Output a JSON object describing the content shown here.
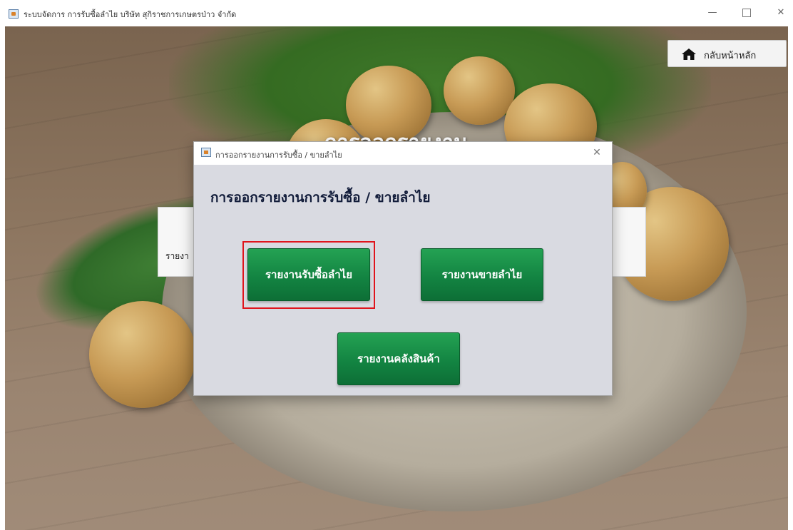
{
  "window": {
    "title": "ระบบจัดการ การรับซื้อลำไย บริษัท สุกิราชการเกษตรป่าว จำกัด",
    "minimize_glyph": "—",
    "close_glyph": "✕"
  },
  "main": {
    "heading": "การออกรายงาน",
    "home_button_label": "กลับหน้าหลัก",
    "home_icon": "home-icon",
    "left_card_label": "รายงา"
  },
  "dialog": {
    "title": "การออกรายงานการรับซื้อ / ขายลำไย",
    "close_glyph": "✕",
    "heading": "การออกรายงานการรับซื้อ / ขายลำไย",
    "buttons": {
      "buy_report": "รายงานรับซื้อลำไย",
      "sell_report": "รายงานขายลำไย",
      "stock_report": "รายงานคลังสินค้า"
    },
    "highlight_color": "#e0141c",
    "button_color": "#138442"
  }
}
